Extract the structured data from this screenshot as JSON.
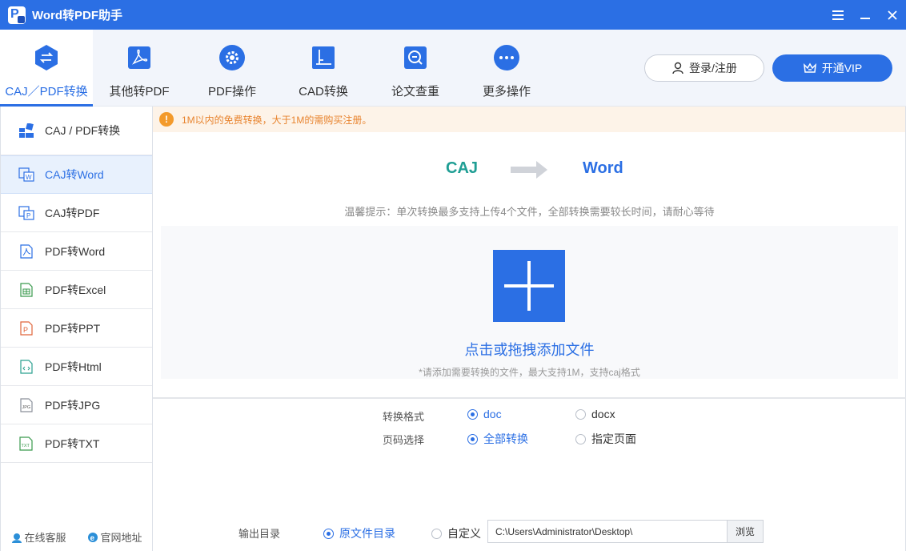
{
  "window": {
    "title": "Word转PDF助手",
    "logo_letter": "P"
  },
  "toolbar": {
    "tabs": [
      {
        "label": "CAJ／PDF转换",
        "icon": "swap-arrows-icon",
        "active": true
      },
      {
        "label": "其他转PDF",
        "icon": "pdf-file-icon",
        "active": false
      },
      {
        "label": "PDF操作",
        "icon": "gear-icon",
        "active": false
      },
      {
        "label": "CAD转换",
        "icon": "cad-icon",
        "active": false
      },
      {
        "label": "论文查重",
        "icon": "document-search-icon",
        "active": false
      },
      {
        "label": "更多操作",
        "icon": "more-dots-icon",
        "active": false
      }
    ],
    "login_label": "登录/注册",
    "vip_label": "开通VIP"
  },
  "sidebar": {
    "items": [
      {
        "label": "CAJ / PDF转换",
        "icon": "grid-icon"
      },
      {
        "label": "CAJ转Word",
        "icon": "caj-word-icon",
        "active": true
      },
      {
        "label": "CAJ转PDF",
        "icon": "caj-pdf-icon"
      },
      {
        "label": "PDF转Word",
        "icon": "pdf-word-icon"
      },
      {
        "label": "PDF转Excel",
        "icon": "pdf-excel-icon"
      },
      {
        "label": "PDF转PPT",
        "icon": "pdf-ppt-icon"
      },
      {
        "label": "PDF转Html",
        "icon": "pdf-html-icon"
      },
      {
        "label": "PDF转JPG",
        "icon": "pdf-jpg-icon"
      },
      {
        "label": "PDF转TXT",
        "icon": "pdf-txt-icon"
      }
    ],
    "footer": {
      "service_label": "在线客服",
      "website_label": "官网地址"
    }
  },
  "main": {
    "notice": "1M以内的免费转换，大于1M的需购买注册。",
    "conversion": {
      "from": "CAJ",
      "to": "Word"
    },
    "tip": "温馨提示：单次转换最多支持上传4个文件，全部转换需要较长时间，请耐心等待",
    "dropzone": {
      "title": "点击或拖拽添加文件",
      "subtitle": "*请添加需要转换的文件，最大支持1M，支持caj格式"
    },
    "format": {
      "label": "转换格式",
      "options": [
        "doc",
        "docx"
      ],
      "selected": "doc"
    },
    "pages": {
      "label": "页码选择",
      "options": [
        "全部转换",
        "指定页面"
      ],
      "selected": "全部转换"
    },
    "output": {
      "label": "输出目录",
      "options": [
        "原文件目录",
        "自定义"
      ],
      "selected": "原文件目录",
      "path": "C:\\Users\\Administrator\\Desktop\\",
      "browse_label": "浏览"
    }
  },
  "colors": {
    "accent": "#2b6fe4",
    "caj": "#1f9e94",
    "notice_text": "#e8842f",
    "notice_bg": "#fdf3e8"
  }
}
